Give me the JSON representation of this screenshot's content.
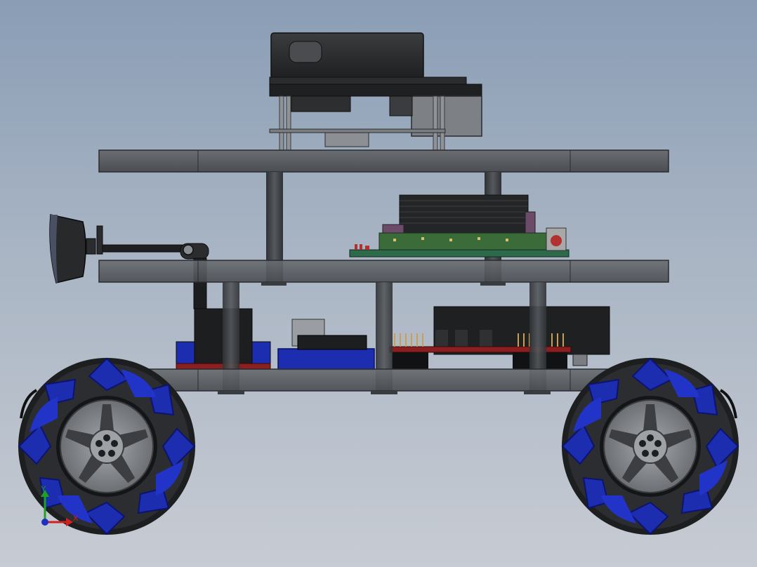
{
  "viewport": {
    "background_top": "#8a9db5",
    "background_bottom": "#c7cbd3"
  },
  "colors": {
    "plate": "#55595e",
    "plate_edge": "#2a2c2f",
    "standoff": "#3d4043",
    "lidar_body": "#2f3133",
    "board_green": "#3c6b3a",
    "pcb_red": "#8b1e1e",
    "heatsink": "#26282a",
    "roller_blue": "#1c2db0",
    "hub_gray": "#8e9196",
    "tire_black": "#202224",
    "axis_x": "#d02020",
    "axis_y": "#20a020",
    "axis_origin": "#2030c0"
  },
  "triad": {
    "y_label": "Y",
    "x_label": "X"
  }
}
